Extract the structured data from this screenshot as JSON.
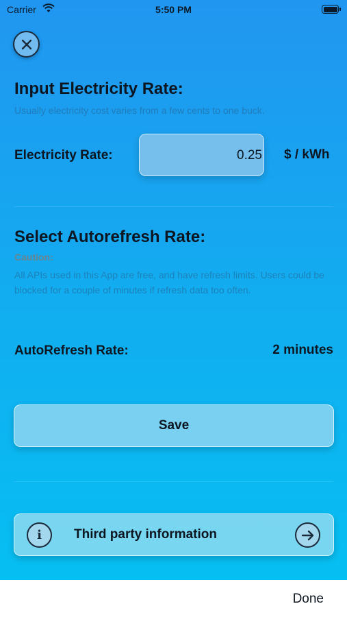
{
  "status_bar": {
    "carrier": "Carrier",
    "time": "5:50 PM"
  },
  "electricity": {
    "title": "Input Electricity Rate:",
    "hint": "Usually electricity cost varies from a few cents to one buck.",
    "label": "Electricity Rate:",
    "value": "0.25",
    "unit": "$ / kWh"
  },
  "autorefresh": {
    "title": "Select Autorefresh Rate:",
    "caution_label": "Caution:",
    "caution_text": "All APIs used in this App are free, and have refresh limits. Users could be blocked for a couple of minutes if refresh data too often.",
    "label": "AutoRefresh Rate:",
    "value": "2 minutes"
  },
  "save_label": "Save",
  "third_party": {
    "label": "Third party information",
    "left_icon": "info-icon",
    "right_icon": "arrow-right-icon"
  },
  "bottom_bar": {
    "done_label": "Done"
  },
  "colors": {
    "gradient_top": "#2196f0",
    "gradient_bottom": "#06bff2"
  }
}
